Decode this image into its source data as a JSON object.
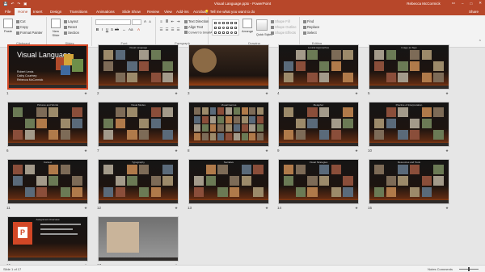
{
  "window": {
    "title": "Visual Language.pptx - PowerPoint",
    "user": "Rebecca McCormick",
    "quick_access": [
      "save-icon",
      "undo-icon",
      "redo-icon",
      "start-from-beginning-icon"
    ],
    "controls": [
      "ribbon-display-icon",
      "minimize-icon",
      "maximize-icon",
      "close-icon"
    ]
  },
  "ribbon_tabs": [
    {
      "label": "File",
      "active": false
    },
    {
      "label": "Home",
      "active": true
    },
    {
      "label": "Insert",
      "active": false
    },
    {
      "label": "Design",
      "active": false
    },
    {
      "label": "Transitions",
      "active": false
    },
    {
      "label": "Animations",
      "active": false
    },
    {
      "label": "Slide Show",
      "active": false
    },
    {
      "label": "Review",
      "active": false
    },
    {
      "label": "View",
      "active": false
    },
    {
      "label": "Add-ins",
      "active": false
    },
    {
      "label": "Acrobat",
      "active": false
    }
  ],
  "tell_me": "Tell me what you want to do",
  "share_label": "Share",
  "ribbon": {
    "clipboard": {
      "label": "Clipboard",
      "paste": "Paste",
      "cut": "Cut",
      "copy": "Copy",
      "format_painter": "Format Painter"
    },
    "slides": {
      "label": "Slides",
      "new_slide": "New Slide",
      "layout": "Layout",
      "reset": "Reset",
      "section": "Section"
    },
    "font": {
      "label": "Font"
    },
    "paragraph": {
      "label": "Paragraph",
      "text_direction": "Text Direction",
      "align_text": "Align Text",
      "convert_smartart": "Convert to SmartArt"
    },
    "drawing": {
      "label": "Drawing",
      "arrange": "Arrange",
      "quick_styles": "Quick Styles",
      "shape_fill": "Shape Fill",
      "shape_outline": "Shape Outline",
      "shape_effects": "Shape Effects"
    },
    "editing": {
      "label": "Editing",
      "find": "Find",
      "replace": "Replace",
      "select": "Select"
    }
  },
  "slides": [
    {
      "number": "1",
      "title": "",
      "kind": "title"
    },
    {
      "number": "2",
      "title": "Visual Language",
      "kind": "collage"
    },
    {
      "number": "3",
      "title": "",
      "kind": "photo"
    },
    {
      "number": "4",
      "title": "Lexical Approaches",
      "kind": "grid"
    },
    {
      "number": "5",
      "title": "Image as Sign",
      "kind": "grid"
    },
    {
      "number": "6",
      "title": "Pictures and Words",
      "kind": "grid"
    },
    {
      "number": "7",
      "title": "Visual Modes",
      "kind": "grid"
    },
    {
      "number": "8",
      "title": "Visual Genres",
      "kind": "dense"
    },
    {
      "number": "9",
      "title": "Metaphor",
      "kind": "grid"
    },
    {
      "number": "10",
      "title": "Practice of Interpretation",
      "kind": "grid"
    },
    {
      "number": "11",
      "title": "Context",
      "kind": "grid"
    },
    {
      "number": "12",
      "title": "Typography",
      "kind": "grid"
    },
    {
      "number": "13",
      "title": "Narrative",
      "kind": "grid"
    },
    {
      "number": "14",
      "title": "Visual Strategies",
      "kind": "grid"
    },
    {
      "number": "15",
      "title": "Resources and Tools",
      "kind": "grid"
    },
    {
      "number": "16",
      "title": "Assignment Overview",
      "kind": "ppt"
    },
    {
      "number": "17",
      "title": "",
      "kind": "portrait"
    }
  ],
  "title_slide": {
    "title": "Visual Language",
    "authors": [
      "Robert Lewis",
      "Cathy Courtney",
      "Rebecca McCormick"
    ]
  },
  "status": {
    "left": "Slide 1 of 17",
    "right": "Notes   Comments"
  },
  "zoom": 0.5
}
